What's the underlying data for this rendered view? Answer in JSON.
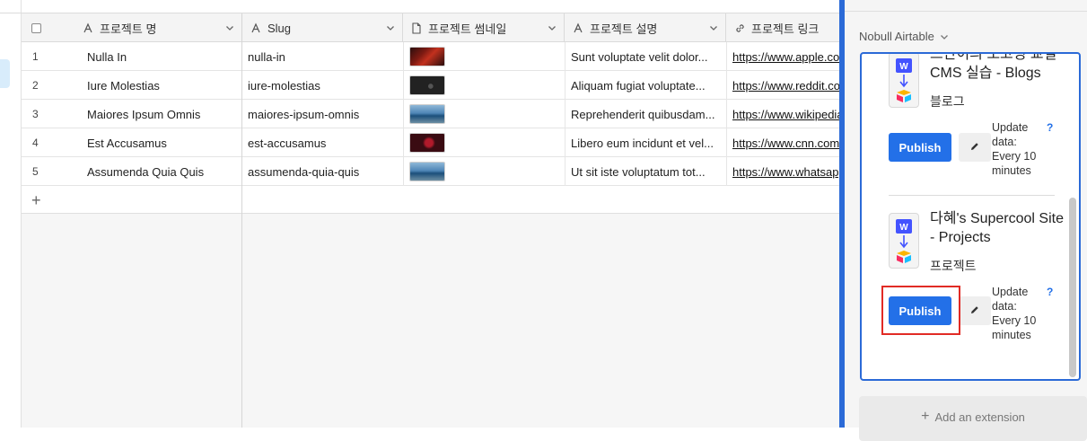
{
  "table": {
    "columns": [
      {
        "icon": "text-field-icon",
        "label": "프로젝트 명"
      },
      {
        "icon": "text-field-icon",
        "label": "Slug"
      },
      {
        "icon": "attachment-icon",
        "label": "프로젝트 썸네일"
      },
      {
        "icon": "text-field-icon",
        "label": "프로젝트 설명"
      },
      {
        "icon": "link-icon",
        "label": "프로젝트 링크"
      }
    ],
    "rows": [
      {
        "num": "1",
        "name": "Nulla In",
        "slug": "nulla-in",
        "thumb": "t-red",
        "desc": "Sunt voluptate velit dolor...",
        "link": "https://www.apple.com"
      },
      {
        "num": "2",
        "name": "Iure Molestias",
        "slug": "iure-molestias",
        "thumb": "t-dark",
        "desc": "Aliquam fugiat voluptate...",
        "link": "https://www.reddit.com"
      },
      {
        "num": "3",
        "name": "Maiores Ipsum Omnis",
        "slug": "maiores-ipsum-omnis",
        "thumb": "t-sea",
        "desc": "Reprehenderit quibusdam...",
        "link": "https://www.wikipedia.org"
      },
      {
        "num": "4",
        "name": "Est Accusamus",
        "slug": "est-accusamus",
        "thumb": "t-crimson",
        "desc": "Libero eum incidunt et vel...",
        "link": "https://www.cnn.com"
      },
      {
        "num": "5",
        "name": "Assumenda Quia Quis",
        "slug": "assumenda-quia-quis",
        "thumb": "t-sea",
        "desc": "Ut sit iste voluptatum tot...",
        "link": "https://www.whatsapp.com"
      }
    ]
  },
  "sidebar": {
    "base_name": "Nobull Airtable",
    "cards": [
      {
        "title": "드단이의 노코딩 교실 CMS 실습 - Blogs",
        "subtitle": "블로그",
        "publish_label": "Publish",
        "update_text": "Update data: Every 10 minutes",
        "help": "?"
      },
      {
        "title": "다혜's Supercool Site - Projects",
        "subtitle": "프로젝트",
        "publish_label": "Publish",
        "update_text": "Update data: Every 10 minutes",
        "help": "?"
      }
    ],
    "add_extension_label": "Add an extension"
  },
  "colors": {
    "accent": "#2370e8",
    "panel_border": "#2b6ad7",
    "highlight_box": "#e12b25"
  }
}
